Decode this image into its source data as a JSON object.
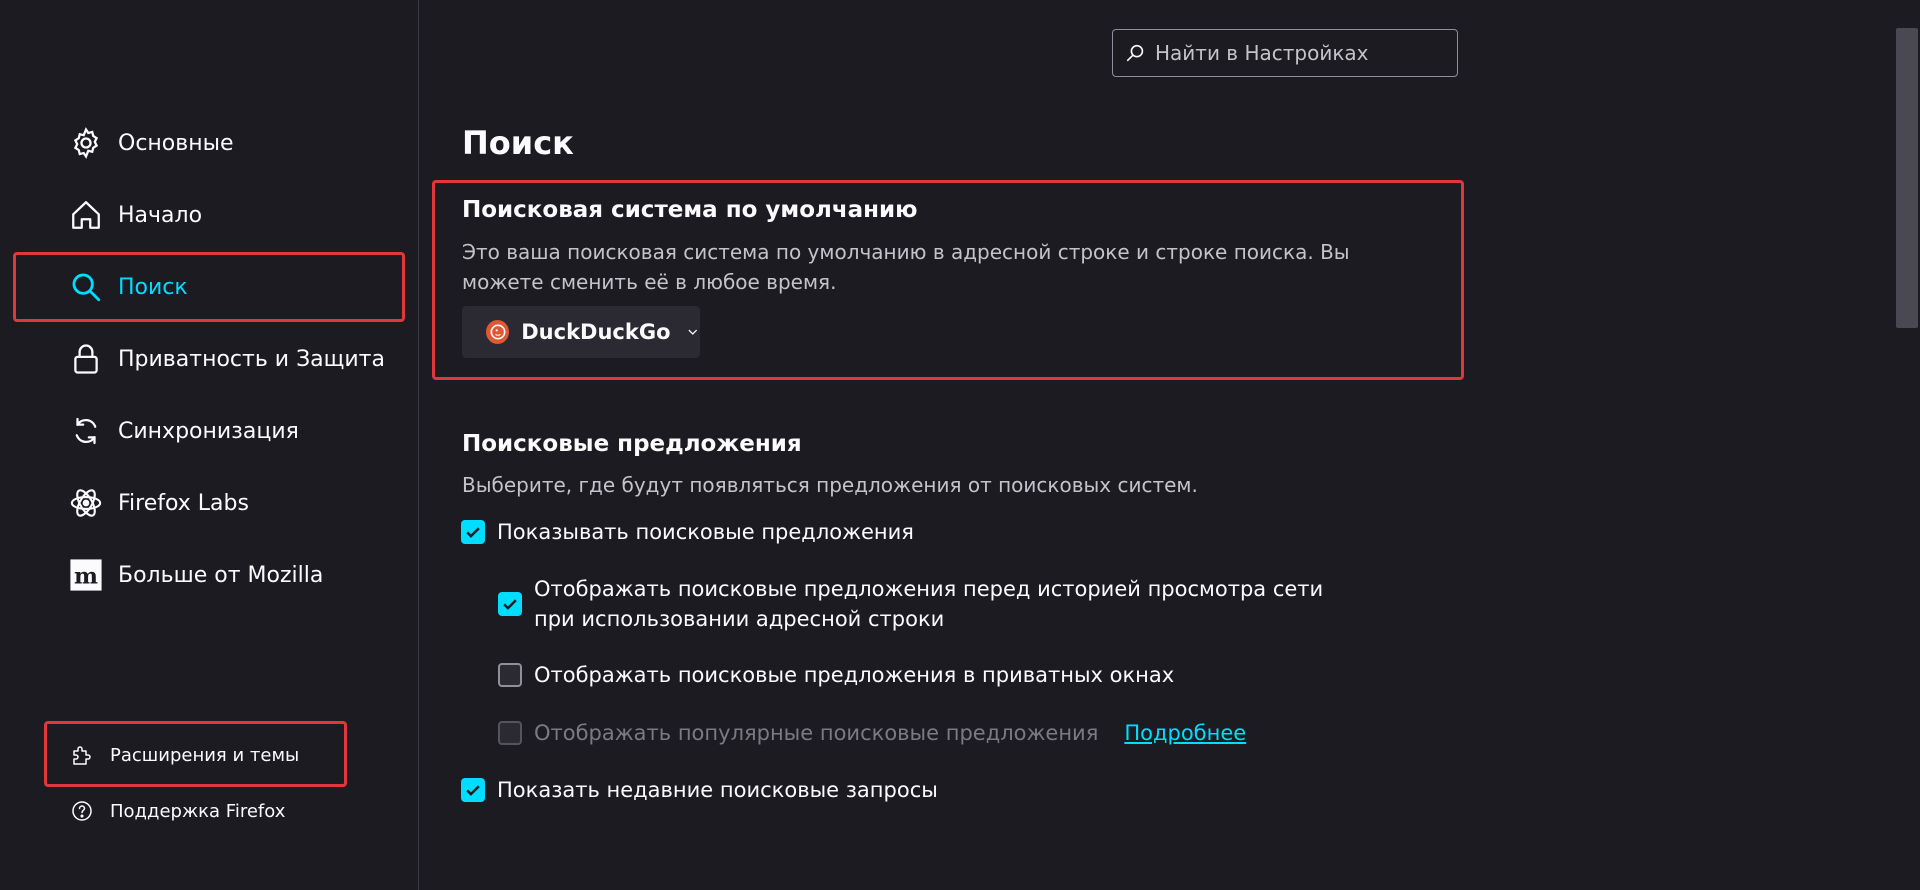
{
  "sidebar": {
    "items": [
      {
        "label": "Основные",
        "icon": "gear-icon"
      },
      {
        "label": "Начало",
        "icon": "home-icon"
      },
      {
        "label": "Поиск",
        "icon": "search-icon",
        "selected": true
      },
      {
        "label": "Приватность и Защита",
        "icon": "lock-icon"
      },
      {
        "label": "Синхронизация",
        "icon": "sync-icon"
      },
      {
        "label": "Firefox Labs",
        "icon": "labs-icon"
      },
      {
        "label": "Больше от Mozilla",
        "icon": "mozilla-icon"
      }
    ],
    "footer": [
      {
        "label": "Расширения и темы",
        "icon": "puzzle-icon"
      },
      {
        "label": "Поддержка Firefox",
        "icon": "help-icon"
      }
    ]
  },
  "search": {
    "placeholder": "Найти в Настройках"
  },
  "page": {
    "title": "Поиск"
  },
  "default_engine": {
    "title": "Поисковая система по умолчанию",
    "description": "Это ваша поисковая система по умолчанию в адресной строке и строке поиска. Вы можете сменить её в любое время.",
    "selected": "DuckDuckGo"
  },
  "suggestions": {
    "title": "Поисковые предложения",
    "description": "Выберите, где будут появляться предложения от поисковых систем.",
    "options": [
      {
        "label": "Показывать поисковые предложения",
        "checked": true
      },
      {
        "label": "Отображать поисковые предложения перед историей просмотра сети при использовании адресной строки",
        "checked": true
      },
      {
        "label": "Отображать поисковые предложения в приватных окнах",
        "checked": false
      },
      {
        "label": "Отображать популярные поисковые предложения",
        "checked": false,
        "disabled": true,
        "link": "Подробнее"
      },
      {
        "label": "Показать недавние поисковые запросы",
        "checked": true
      }
    ]
  },
  "colors": {
    "accent": "#00ddff",
    "highlight": "#e0373d",
    "background": "#1c1b22"
  }
}
